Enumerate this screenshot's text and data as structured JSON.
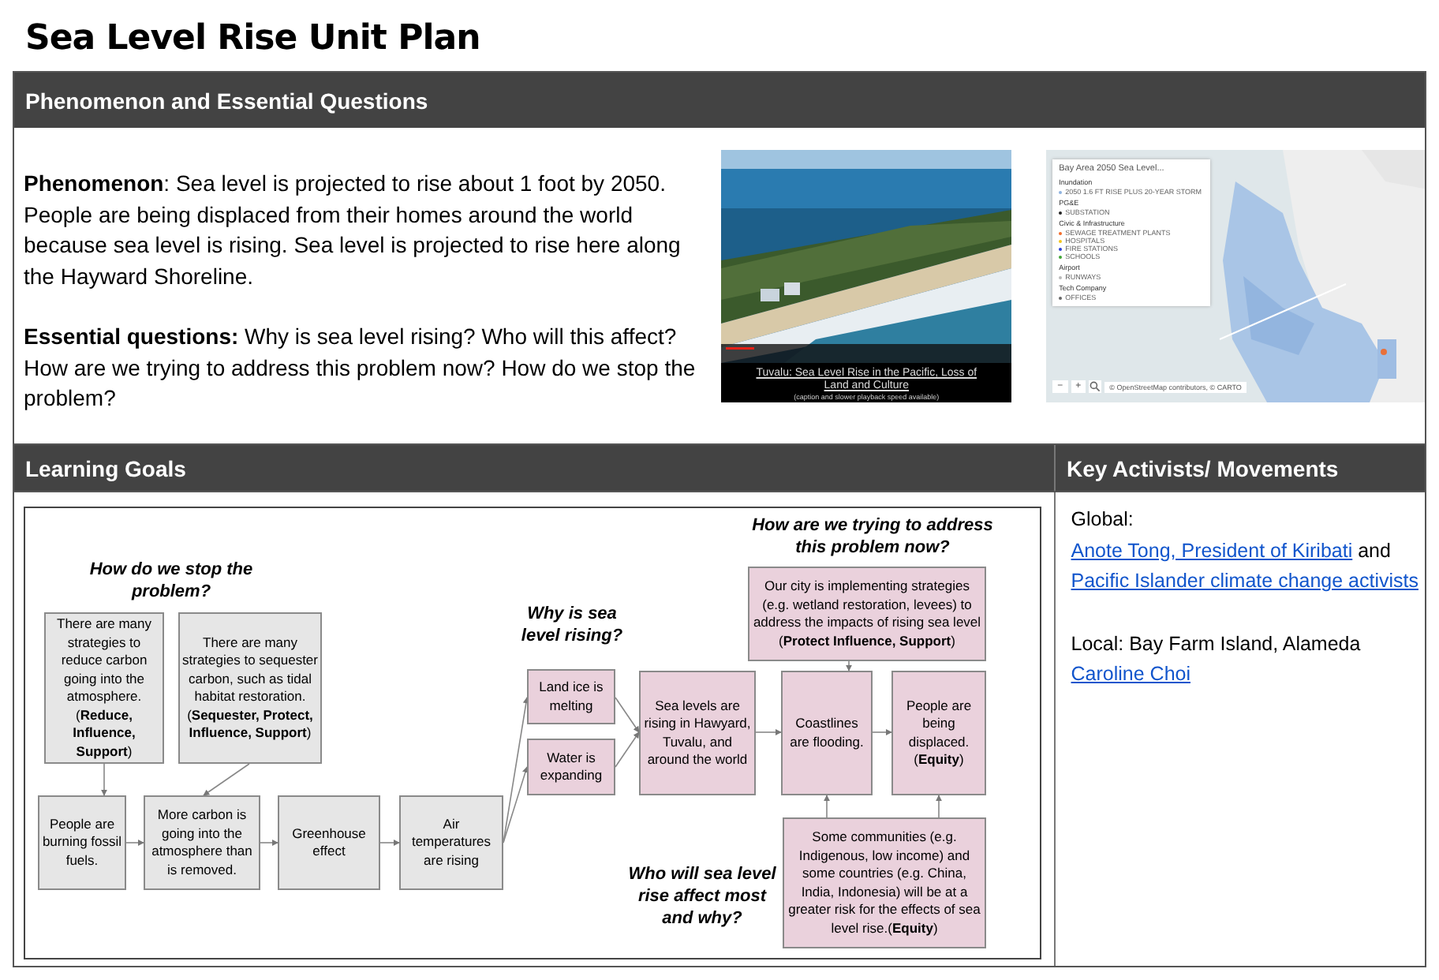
{
  "title": "Sea Level Rise Unit Plan",
  "phenomenon_section": {
    "heading": "Phenomenon and Essential Questions",
    "paragraphs": [
      "**Phenomenon**: Sea level is projected to rise about 1 foot by 2050. People are being displaced from their homes around the world because sea level is rising. Sea level is projected to rise here along the Hayward Shoreline.",
      "**Essential questions:** Why is sea level rising? Who will this affect? How are we trying to address this problem now? How do we stop the problem?"
    ],
    "video": {
      "title": "Tuvalu: Sea Level Rise in the Pacific, Loss of Land and Culture",
      "note": "(caption and slower playback speed available)"
    },
    "map": {
      "legend_title": "Bay Area 2050 Sea Level...",
      "legend_groups": [
        {
          "name": "Inundation",
          "items": [
            {
              "label": "2050 1.6 FT RISE PLUS 20-YEAR STORM",
              "color": "#8fb3e0"
            }
          ]
        },
        {
          "name": "PG&E",
          "items": [
            {
              "label": "SUBSTATION",
              "color": "#222222"
            }
          ]
        },
        {
          "name": "Civic & Infrastructure",
          "items": [
            {
              "label": "SEWAGE TREATMENT PLANTS",
              "color": "#f26c2a"
            },
            {
              "label": "HOSPITALS",
              "color": "#f2c51c"
            },
            {
              "label": "FIRE STATIONS",
              "color": "#2a3fd6"
            },
            {
              "label": "SCHOOLS",
              "color": "#3fa535"
            }
          ]
        },
        {
          "name": "Airport",
          "items": [
            {
              "label": "RUNWAYS",
              "color": "#bbbbbb"
            }
          ]
        },
        {
          "name": "Tech Company",
          "items": [
            {
              "label": "OFFICES",
              "color": "#666666"
            }
          ]
        }
      ],
      "zoom_out": "−",
      "zoom_in": "+",
      "attribution": "© OpenStreetMap contributors, © CARTO"
    }
  },
  "learning_goals": {
    "heading": "Learning Goals",
    "diagram": {
      "questions": [
        "How do we stop the problem?",
        "Why is sea level rising?",
        "How are we trying to address this problem now?",
        "Who will sea level rise affect most and why?"
      ],
      "boxes": [
        {
          "text": "There are many strategies to reduce carbon going into the atmosphere. (**Reduce, Influence, Support**)",
          "color": "#e6e6e6"
        },
        {
          "text": "There are many strategies to sequester carbon, such as tidal habitat restoration. (**Sequester, Protect, Influence, Support**)",
          "color": "#e6e6e6"
        },
        {
          "text": "People are burning fossil fuels.",
          "color": "#e6e6e6"
        },
        {
          "text": "More carbon is going into the atmosphere than is removed.",
          "color": "#e6e6e6"
        },
        {
          "text": "Greenhouse effect",
          "color": "#e6e6e6"
        },
        {
          "text": "Air temperatures are rising",
          "color": "#e6e6e6"
        },
        {
          "text": "Our city is implementing strategies (e.g. wetland restoration, levees) to address the impacts of rising sea level (**Protect Influence, Support**)",
          "color": "#ead1dc"
        },
        {
          "text": "Land ice is melting",
          "color": "#ead1dc"
        },
        {
          "text": "Water is expanding",
          "color": "#ead1dc"
        },
        {
          "text": "Sea levels are rising in Hawyard, Tuvalu, and around the world",
          "color": "#ead1dc"
        },
        {
          "text": "Coastlines are flooding.",
          "color": "#ead1dc"
        },
        {
          "text": "People are being displaced. (**Equity**)",
          "color": "#ead1dc"
        },
        {
          "text": "Some communities (e.g. Indigenous, low income) and some countries (e.g. China, India, Indonesia) will be at a greater risk for the effects of sea level rise.(**Equity**)",
          "color": "#ead1dc"
        }
      ]
    }
  },
  "activists": {
    "heading": "Key Activists/ Movements",
    "paragraphs": [
      [
        {
          "kind": "text",
          "text": "Global: "
        },
        {
          "kind": "link",
          "text": "Anote Tong, President of Kiribati"
        },
        {
          "kind": "text",
          "text": " and "
        },
        {
          "kind": "link",
          "text": "Pacific Islander climate change activists"
        }
      ],
      [
        {
          "kind": "text",
          "text": "Local: Bay Farm Island, Alameda "
        },
        {
          "kind": "link",
          "text": "Caroline Choi"
        }
      ]
    ]
  }
}
